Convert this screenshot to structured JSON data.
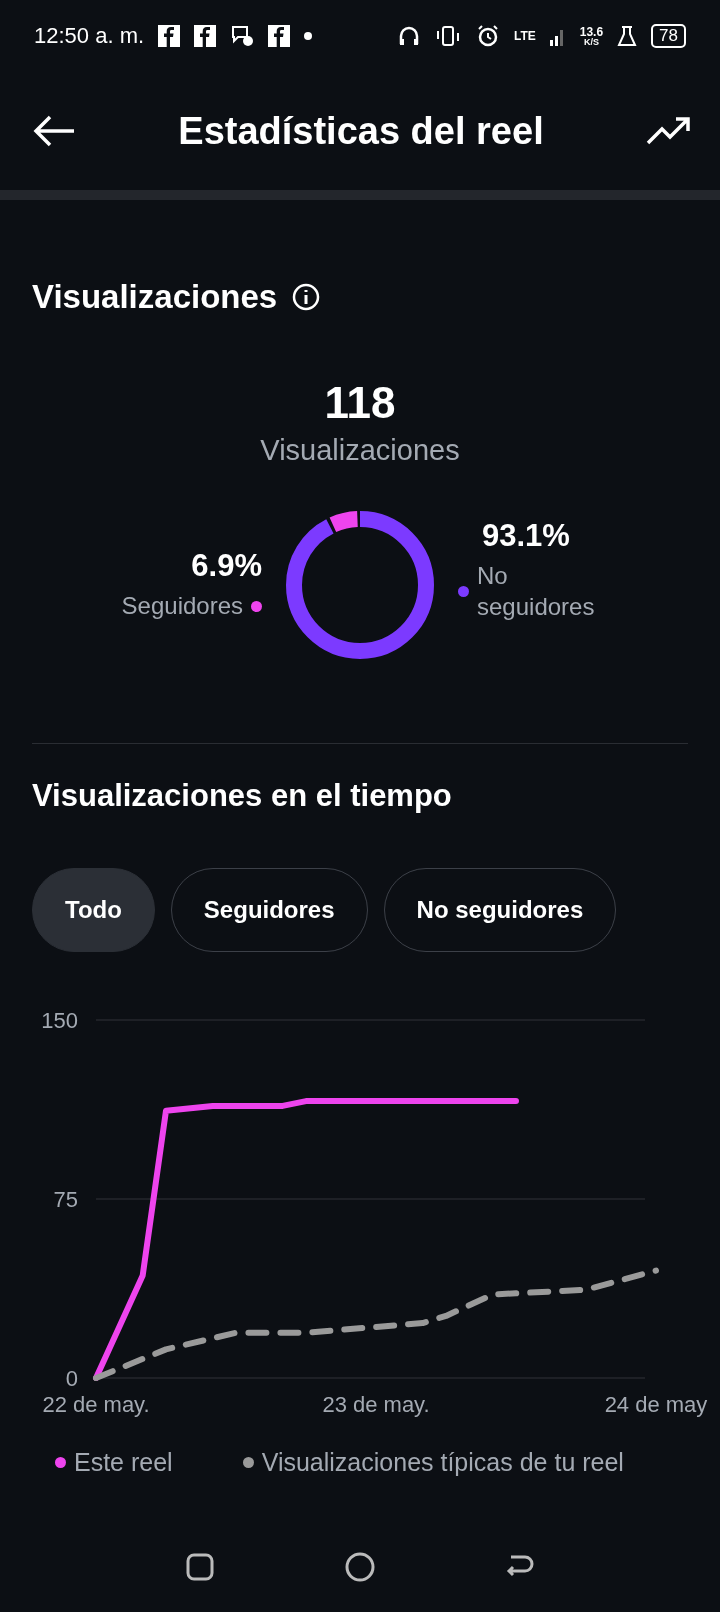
{
  "status_bar": {
    "time": "12:50 a. m.",
    "network": "LTE",
    "speed": "13.6",
    "speed_unit": "K/S",
    "battery": "78"
  },
  "header": {
    "title": "Estadísticas del reel"
  },
  "views": {
    "heading": "Visualizaciones",
    "total": "118",
    "total_label": "Visualizaciones",
    "segments": [
      {
        "percent": "6.9%",
        "label": "Seguidores",
        "color": "#ee44ee"
      },
      {
        "percent": "93.1%",
        "label": "No seguidores",
        "color": "#7c3aff"
      }
    ]
  },
  "over_time": {
    "heading": "Visualizaciones en el tiempo",
    "filters": [
      {
        "label": "Todo",
        "selected": true
      },
      {
        "label": "Seguidores",
        "selected": false
      },
      {
        "label": "No seguidores",
        "selected": false
      }
    ],
    "chart_data": {
      "type": "line",
      "ylim": [
        0,
        150
      ],
      "yticks": [
        0,
        75,
        150
      ],
      "categories": [
        "22 de may.",
        null,
        null,
        null,
        null,
        null,
        null,
        null,
        null,
        null,
        null,
        null,
        "23 de may.",
        null,
        null,
        null,
        null,
        null,
        null,
        null,
        null,
        null,
        null,
        null,
        "24 de may"
      ],
      "series": [
        {
          "name": "Este reel",
          "color": "#ee44ee",
          "line_style": "solid",
          "values": [
            0,
            null,
            43,
            112,
            null,
            114,
            null,
            null,
            114,
            116,
            null,
            null,
            null,
            null,
            null,
            null,
            null,
            null,
            116,
            null,
            null,
            null,
            null,
            null,
            null
          ]
        },
        {
          "name": "Visualizaciones típicas de tu reel",
          "color": "#9a9a9a",
          "line_style": "dashed",
          "values": [
            0,
            4,
            null,
            12,
            null,
            null,
            19,
            null,
            null,
            19,
            null,
            null,
            null,
            null,
            23,
            26,
            null,
            35,
            null,
            null,
            null,
            37,
            null,
            null,
            45
          ]
        }
      ]
    }
  }
}
